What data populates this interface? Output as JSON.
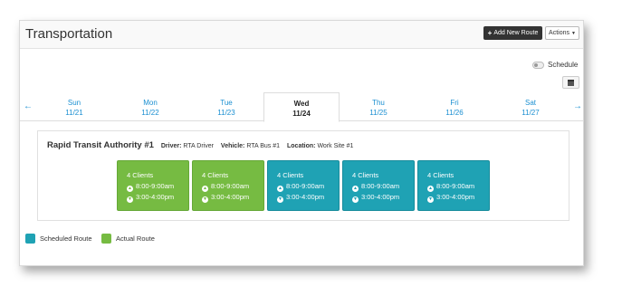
{
  "header": {
    "title": "Transportation",
    "add_route_label": "Add New Route",
    "actions_label": "Actions"
  },
  "schedule": {
    "label": "Schedule",
    "toggle_on": false
  },
  "days": [
    {
      "name": "Sun",
      "date": "11/21",
      "active": false
    },
    {
      "name": "Mon",
      "date": "11/22",
      "active": false
    },
    {
      "name": "Tue",
      "date": "11/23",
      "active": false
    },
    {
      "name": "Wed",
      "date": "11/24",
      "active": true
    },
    {
      "name": "Thu",
      "date": "11/25",
      "active": false
    },
    {
      "name": "Fri",
      "date": "11/26",
      "active": false
    },
    {
      "name": "Sat",
      "date": "11/27",
      "active": false
    }
  ],
  "route": {
    "name": "Rapid Transit Authority #1",
    "driver_label": "Driver:",
    "driver": "RTA Driver",
    "vehicle_label": "Vehicle:",
    "vehicle": "RTA Bus #1",
    "location_label": "Location:",
    "location": "Work Site #1",
    "cards": [
      {
        "type": "actual",
        "clients": "4 Clients",
        "pickup": "8:00-9:00am",
        "dropoff": "3:00-4:00pm"
      },
      {
        "type": "actual",
        "clients": "4 Clients",
        "pickup": "8:00-9:00am",
        "dropoff": "3:00-4:00pm"
      },
      {
        "type": "scheduled",
        "clients": "4 Clients",
        "pickup": "8:00-9:00am",
        "dropoff": "3:00-4:00pm"
      },
      {
        "type": "scheduled",
        "clients": "4 Clients",
        "pickup": "8:00-9:00am",
        "dropoff": "3:00-4:00pm"
      },
      {
        "type": "scheduled",
        "clients": "4 Clients",
        "pickup": "8:00-9:00am",
        "dropoff": "3:00-4:00pm"
      }
    ]
  },
  "legend": {
    "scheduled_label": "Scheduled Route",
    "actual_label": "Actual Route"
  },
  "colors": {
    "scheduled": "#1fa2b4",
    "actual": "#76bb42",
    "link": "#1a8fd1"
  },
  "icons": [
    "plus-icon",
    "caret-down-icon",
    "calendar-icon",
    "arrow-left-icon",
    "arrow-right-icon",
    "arrow-up-circle-icon",
    "arrow-down-circle-icon"
  ]
}
